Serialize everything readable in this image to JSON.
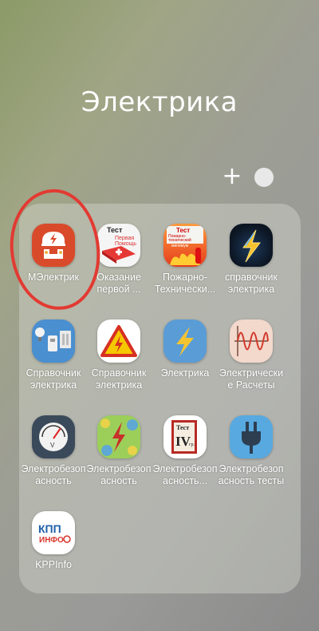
{
  "folder": {
    "title": "Электрика",
    "add_label": "+"
  },
  "apps": [
    {
      "label": "МЭлектрик",
      "icon": "electrician-worker-icon"
    },
    {
      "label": "Оказание\nпервой ...",
      "icon": "first-aid-test-icon",
      "icon_text": [
        "Тест",
        "Первая",
        "Помощь"
      ]
    },
    {
      "label": "Пожарно-\nТехнически...",
      "icon": "fire-safety-test-icon",
      "icon_text": [
        "Тест",
        "Пожарно-",
        "технический",
        "минимум"
      ]
    },
    {
      "label": "справочник\nэлектрика",
      "icon": "lightning-dark-icon"
    },
    {
      "label": "Справочник\nэлектрика",
      "icon": "electrical-devices-icon"
    },
    {
      "label": "Справочник\nэлектрика",
      "icon": "high-voltage-warning-icon"
    },
    {
      "label": "Электрика",
      "icon": "lightning-blue-icon"
    },
    {
      "label": "Электрически\nе Расчеты",
      "icon": "sine-wave-icon"
    },
    {
      "label": "Электробезоп\nасность",
      "icon": "voltmeter-gauge-icon"
    },
    {
      "label": "Электробезоп\nасность",
      "icon": "lightning-pattern-icon"
    },
    {
      "label": "Электробезоп\nасность...",
      "icon": "test-book-iv-icon",
      "icon_text": [
        "Тест",
        "IV",
        "гр."
      ]
    },
    {
      "label": "Электробезоп\nасность тесты",
      "icon": "power-plug-icon"
    },
    {
      "label": "KPPInfo",
      "icon": "kpp-info-icon",
      "icon_text": [
        "КПП",
        "ИНФО"
      ]
    }
  ],
  "colors": {
    "annotation_circle": "#e23a32",
    "melectric_bg": "#d94a2b"
  }
}
